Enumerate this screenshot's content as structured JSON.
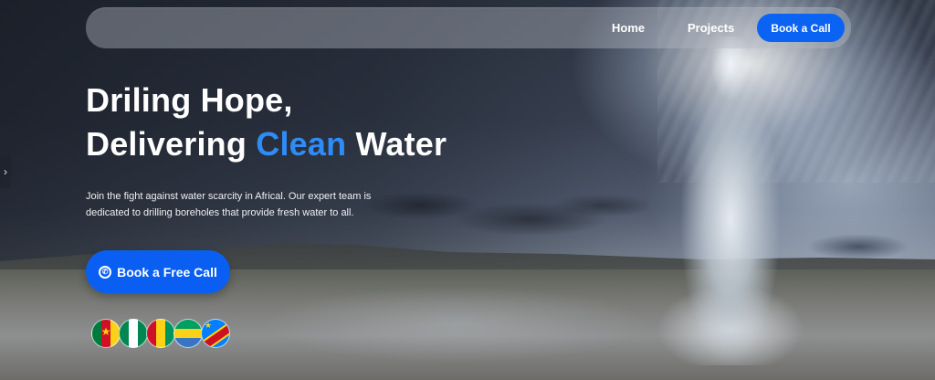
{
  "nav": {
    "home": "Home",
    "projects": "Projects",
    "cta": "Book a Call"
  },
  "hero": {
    "headline_line1": "Driling Hope,",
    "headline_line2_start": "Delivering",
    "headline_line2_accent": "Clean",
    "headline_line2_end": "Water",
    "subtext": "Join the fight against water scarcity in Africal. Our expert team is dedicated to drilling boreholes that provide fresh water to all.",
    "cta_label": "Book a Free Call"
  },
  "side_handle": {
    "glyph": "›"
  },
  "flags": [
    {
      "name": "cameroon-flag"
    },
    {
      "name": "nigeria-flag"
    },
    {
      "name": "guinea-flag"
    },
    {
      "name": "gabon-flag"
    },
    {
      "name": "dr-congo-flag"
    }
  ],
  "colors": {
    "accent": "#2f8bf5",
    "button": "#0a5ff2",
    "nav_bg": "rgba(180,185,195,0.42)"
  },
  "icons": {
    "cta_icon": "whatsapp-icon",
    "side_handle_icon": "chevron-right-icon"
  }
}
